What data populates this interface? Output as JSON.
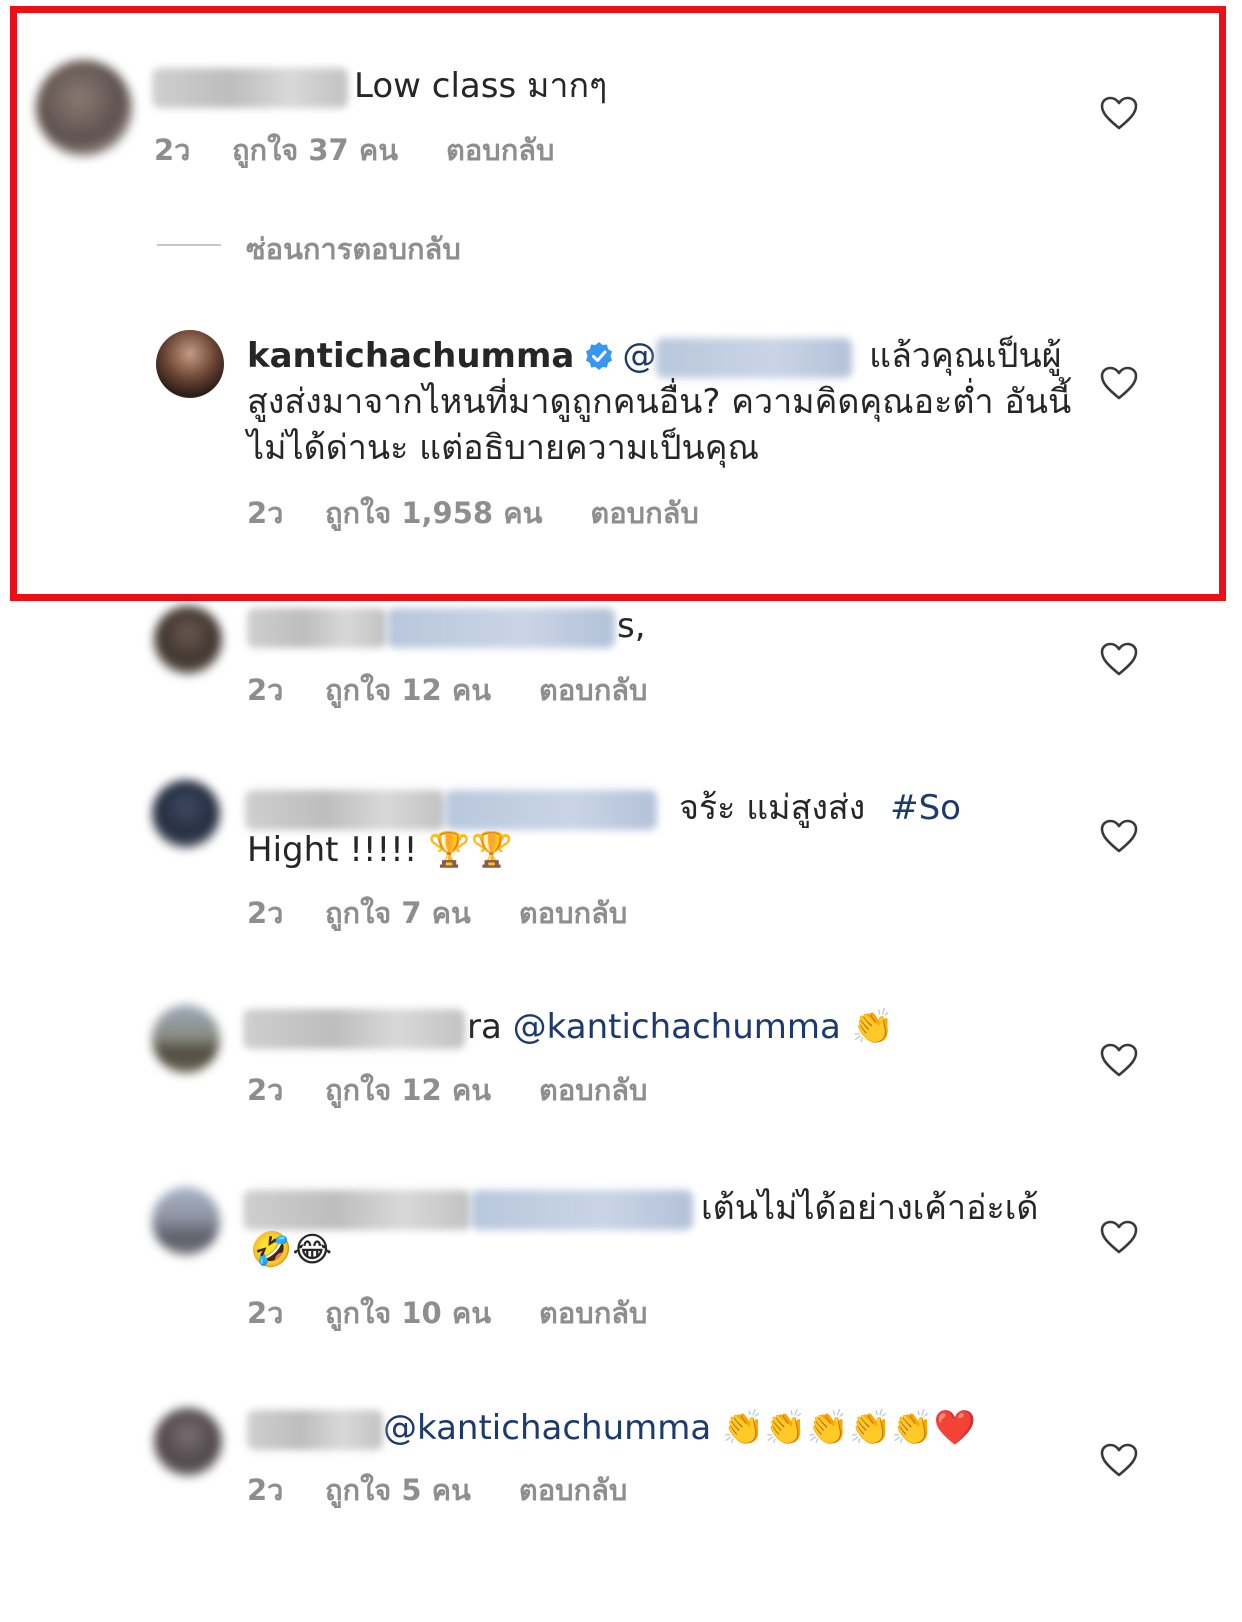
{
  "comments": [
    {
      "text": "Low class มากๆ",
      "time": "2ว",
      "likes": "ถูกใจ 37 คน",
      "reply": "ตอบกลับ"
    },
    {
      "username": "kantichachumma",
      "mention_prefix": "@",
      "line1": "แล้วคุณเป็นผู้",
      "line2": "สูงส่งมาจากไหนที่มาดูถูกคนอื่น? ความคิดคุณอะต่ำ อันนี้",
      "line3": "ไม่ได้ด่านะ แต่อธิบายความเป็นคุณ",
      "time": "2ว",
      "likes": "ถูกใจ 1,958 คน",
      "reply": "ตอบกลับ"
    },
    {
      "text": "s,",
      "time": "2ว",
      "likes": "ถูกใจ 12 คน",
      "reply": "ตอบกลับ"
    },
    {
      "text": "จร้ะ แม่สูงส่ง",
      "hashtag": "#So",
      "line2": "Hight !!!!!",
      "emoji": "🏆🏆",
      "time": "2ว",
      "likes": "ถูกใจ 7 คน",
      "reply": "ตอบกลับ"
    },
    {
      "name_tail": "ra",
      "mention": "@kantichachumma",
      "emoji": "👏",
      "time": "2ว",
      "likes": "ถูกใจ 12 คน",
      "reply": "ตอบกลับ"
    },
    {
      "text": "เต้นไม่ได้อย่างเค้าอ่ะเด้",
      "emoji": "🤣😂",
      "time": "2ว",
      "likes": "ถูกใจ 10 คน",
      "reply": "ตอบกลับ"
    },
    {
      "mention": "@kantichachumma",
      "emoji": "👏👏👏👏👏❤️",
      "time": "2ว",
      "likes": "ถูกใจ 5 คน",
      "reply": "ตอบกลับ"
    }
  ],
  "hide_replies": "ซ่อนการตอบกลับ",
  "colors": {
    "highlight": "#ec1016",
    "mention": "#1d3a6f",
    "meta": "#8e8e8e",
    "verified": "#3897f0"
  }
}
